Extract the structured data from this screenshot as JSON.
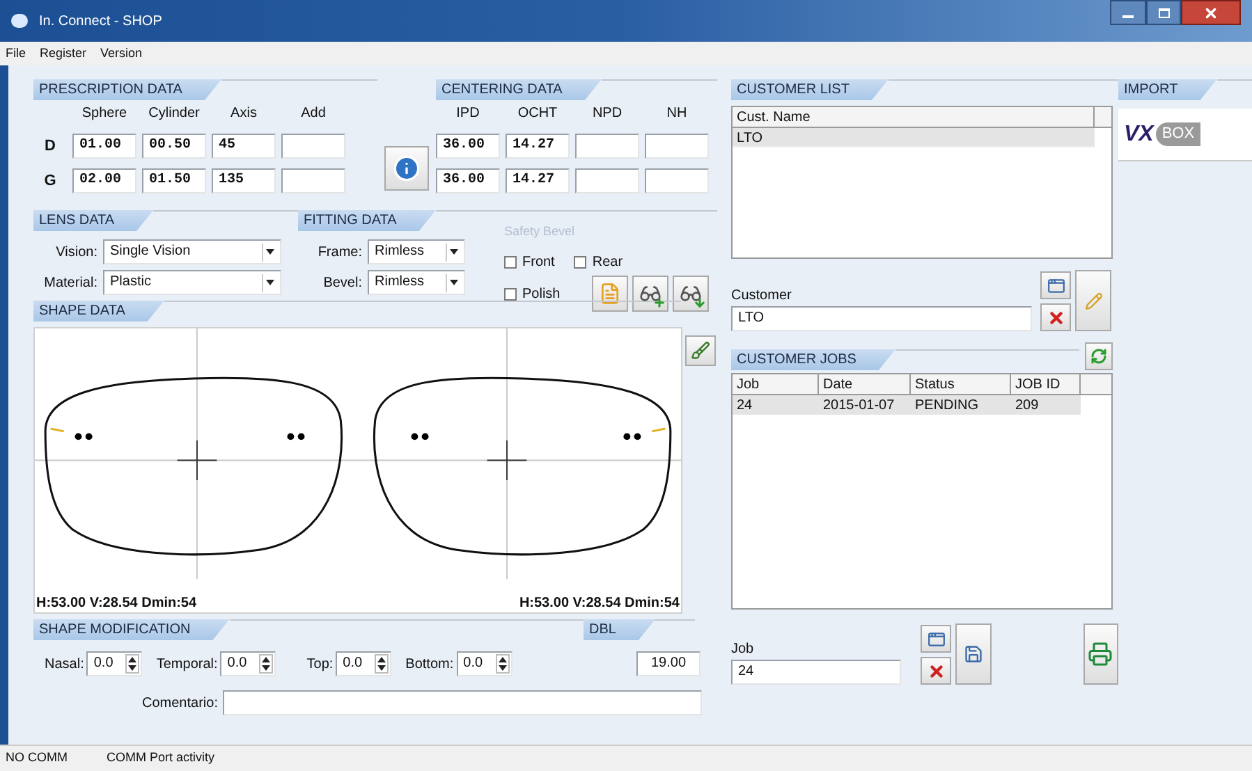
{
  "window": {
    "title": "In. Connect - SHOP"
  },
  "menu": [
    "File",
    "Register",
    "Version"
  ],
  "prescription": {
    "title": "PRESCRIPTION DATA",
    "columns": [
      "Sphere",
      "Cylinder",
      "Axis",
      "Add"
    ],
    "rows": [
      {
        "label": "D",
        "values": [
          "01.00",
          "00.50",
          "45"
        ]
      },
      {
        "label": "G",
        "values": [
          "02.00",
          "01.50",
          "135"
        ]
      }
    ]
  },
  "centering": {
    "title": "CENTERING DATA",
    "columns": [
      "IPD",
      "OCHT",
      "NPD",
      "NH"
    ],
    "rows": [
      {
        "values": [
          "36.00",
          "14.27"
        ]
      },
      {
        "values": [
          "36.00",
          "14.27"
        ]
      }
    ]
  },
  "lens_data": {
    "title": "LENS DATA",
    "fields": [
      {
        "label": "Vision:",
        "value": "Single Vision"
      },
      {
        "label": "Material:",
        "value": "Plastic"
      }
    ]
  },
  "fitting_data": {
    "title": "FITTING DATA",
    "fields": [
      {
        "label": "Frame:",
        "value": "Rimless"
      },
      {
        "label": "Bevel:",
        "value": "Rimless"
      }
    ]
  },
  "safety_bevel": {
    "title": "Safety Bevel",
    "options": [
      {
        "label": "Front",
        "checked": false
      },
      {
        "label": "Rear",
        "checked": false
      },
      {
        "label": "Polish",
        "checked": false
      }
    ]
  },
  "shape_data": {
    "title": "SHAPE DATA",
    "readings": [
      "H:53.00 V:28.54 Dmin:54",
      "H:53.00 V:28.54 Dmin:54"
    ]
  },
  "shape_modification": {
    "title": "SHAPE MODIFICATION",
    "spinners": [
      {
        "label": "Nasal:",
        "value": "0.0"
      },
      {
        "label": "Temporal:",
        "value": "0.0"
      },
      {
        "label": "Top:",
        "value": "0.0"
      },
      {
        "label": "Bottom:",
        "value": "0.0"
      }
    ],
    "comment_label": "Comentario:"
  },
  "dbl": {
    "title": "DBL",
    "value": "19.00"
  },
  "customer_list": {
    "title": "CUSTOMER LIST",
    "column": "Cust. Name",
    "rows": [
      {
        "name": "LTO",
        "selected": true
      }
    ]
  },
  "customer": {
    "label": "Customer",
    "value": "LTO"
  },
  "customer_jobs": {
    "title": "CUSTOMER JOBS",
    "columns": [
      "Job",
      "Date",
      "Status",
      "JOB ID"
    ],
    "rows": [
      {
        "cells": [
          "24",
          "2015-01-07",
          "PENDING",
          "209"
        ],
        "selected": true
      }
    ]
  },
  "job": {
    "label": "Job",
    "value": "24"
  },
  "import": {
    "title": "IMPORT",
    "logo_mark": "VX",
    "logo_word": "BOX"
  },
  "status_bar": [
    "NO COMM",
    "COMM Port activity"
  ]
}
